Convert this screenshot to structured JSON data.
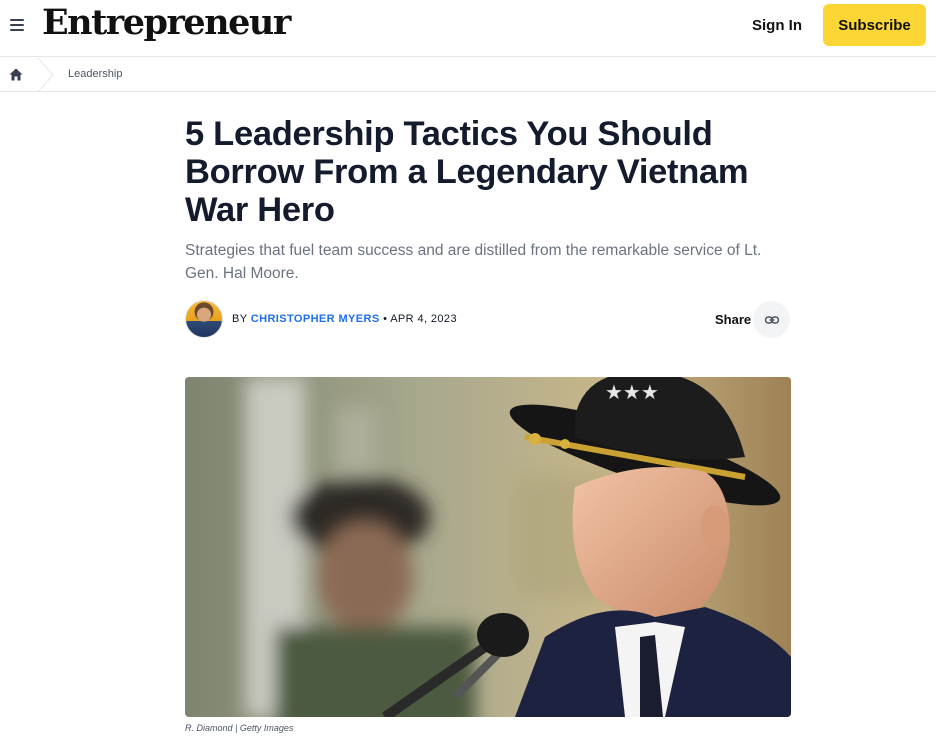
{
  "header": {
    "logo": "Entrepreneur",
    "sign_in": "Sign In",
    "subscribe": "Subscribe"
  },
  "breadcrumb": {
    "section": "Leadership"
  },
  "article": {
    "title": "5 Leadership Tactics You Should Borrow From a Legendary Vietnam War Hero",
    "dek": "Strategies that fuel team success and are distilled from the remarkable service of Lt. Gen. Hal Moore.",
    "by": "BY",
    "author": "CHRISTOPHER MYERS",
    "date_sep": "•",
    "date": "APR 4, 2023",
    "share": "Share",
    "photo_credit": "R. Diamond | Getty Images"
  },
  "colors": {
    "subscribe_bg": "#fcd635",
    "author_link": "#1f6feb",
    "title": "#141b2d",
    "dek": "#6b7280"
  },
  "icons": {
    "menu": "hamburger-menu-icon",
    "home": "home-icon",
    "share": "link-icon"
  }
}
